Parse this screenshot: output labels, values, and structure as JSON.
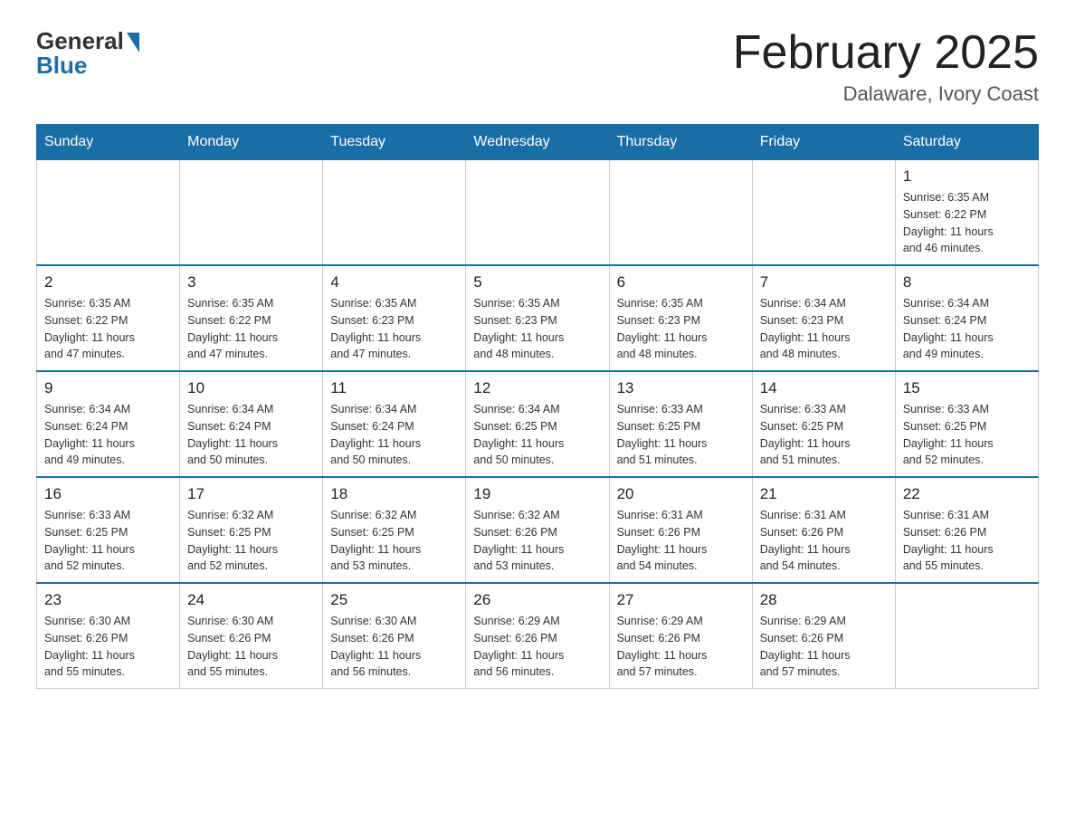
{
  "logo": {
    "general": "General",
    "blue": "Blue"
  },
  "title": "February 2025",
  "location": "Dalaware, Ivory Coast",
  "days_of_week": [
    "Sunday",
    "Monday",
    "Tuesday",
    "Wednesday",
    "Thursday",
    "Friday",
    "Saturday"
  ],
  "weeks": [
    [
      {
        "day": "",
        "info": ""
      },
      {
        "day": "",
        "info": ""
      },
      {
        "day": "",
        "info": ""
      },
      {
        "day": "",
        "info": ""
      },
      {
        "day": "",
        "info": ""
      },
      {
        "day": "",
        "info": ""
      },
      {
        "day": "1",
        "info": "Sunrise: 6:35 AM\nSunset: 6:22 PM\nDaylight: 11 hours\nand 46 minutes."
      }
    ],
    [
      {
        "day": "2",
        "info": "Sunrise: 6:35 AM\nSunset: 6:22 PM\nDaylight: 11 hours\nand 47 minutes."
      },
      {
        "day": "3",
        "info": "Sunrise: 6:35 AM\nSunset: 6:22 PM\nDaylight: 11 hours\nand 47 minutes."
      },
      {
        "day": "4",
        "info": "Sunrise: 6:35 AM\nSunset: 6:23 PM\nDaylight: 11 hours\nand 47 minutes."
      },
      {
        "day": "5",
        "info": "Sunrise: 6:35 AM\nSunset: 6:23 PM\nDaylight: 11 hours\nand 48 minutes."
      },
      {
        "day": "6",
        "info": "Sunrise: 6:35 AM\nSunset: 6:23 PM\nDaylight: 11 hours\nand 48 minutes."
      },
      {
        "day": "7",
        "info": "Sunrise: 6:34 AM\nSunset: 6:23 PM\nDaylight: 11 hours\nand 48 minutes."
      },
      {
        "day": "8",
        "info": "Sunrise: 6:34 AM\nSunset: 6:24 PM\nDaylight: 11 hours\nand 49 minutes."
      }
    ],
    [
      {
        "day": "9",
        "info": "Sunrise: 6:34 AM\nSunset: 6:24 PM\nDaylight: 11 hours\nand 49 minutes."
      },
      {
        "day": "10",
        "info": "Sunrise: 6:34 AM\nSunset: 6:24 PM\nDaylight: 11 hours\nand 50 minutes."
      },
      {
        "day": "11",
        "info": "Sunrise: 6:34 AM\nSunset: 6:24 PM\nDaylight: 11 hours\nand 50 minutes."
      },
      {
        "day": "12",
        "info": "Sunrise: 6:34 AM\nSunset: 6:25 PM\nDaylight: 11 hours\nand 50 minutes."
      },
      {
        "day": "13",
        "info": "Sunrise: 6:33 AM\nSunset: 6:25 PM\nDaylight: 11 hours\nand 51 minutes."
      },
      {
        "day": "14",
        "info": "Sunrise: 6:33 AM\nSunset: 6:25 PM\nDaylight: 11 hours\nand 51 minutes."
      },
      {
        "day": "15",
        "info": "Sunrise: 6:33 AM\nSunset: 6:25 PM\nDaylight: 11 hours\nand 52 minutes."
      }
    ],
    [
      {
        "day": "16",
        "info": "Sunrise: 6:33 AM\nSunset: 6:25 PM\nDaylight: 11 hours\nand 52 minutes."
      },
      {
        "day": "17",
        "info": "Sunrise: 6:32 AM\nSunset: 6:25 PM\nDaylight: 11 hours\nand 52 minutes."
      },
      {
        "day": "18",
        "info": "Sunrise: 6:32 AM\nSunset: 6:25 PM\nDaylight: 11 hours\nand 53 minutes."
      },
      {
        "day": "19",
        "info": "Sunrise: 6:32 AM\nSunset: 6:26 PM\nDaylight: 11 hours\nand 53 minutes."
      },
      {
        "day": "20",
        "info": "Sunrise: 6:31 AM\nSunset: 6:26 PM\nDaylight: 11 hours\nand 54 minutes."
      },
      {
        "day": "21",
        "info": "Sunrise: 6:31 AM\nSunset: 6:26 PM\nDaylight: 11 hours\nand 54 minutes."
      },
      {
        "day": "22",
        "info": "Sunrise: 6:31 AM\nSunset: 6:26 PM\nDaylight: 11 hours\nand 55 minutes."
      }
    ],
    [
      {
        "day": "23",
        "info": "Sunrise: 6:30 AM\nSunset: 6:26 PM\nDaylight: 11 hours\nand 55 minutes."
      },
      {
        "day": "24",
        "info": "Sunrise: 6:30 AM\nSunset: 6:26 PM\nDaylight: 11 hours\nand 55 minutes."
      },
      {
        "day": "25",
        "info": "Sunrise: 6:30 AM\nSunset: 6:26 PM\nDaylight: 11 hours\nand 56 minutes."
      },
      {
        "day": "26",
        "info": "Sunrise: 6:29 AM\nSunset: 6:26 PM\nDaylight: 11 hours\nand 56 minutes."
      },
      {
        "day": "27",
        "info": "Sunrise: 6:29 AM\nSunset: 6:26 PM\nDaylight: 11 hours\nand 57 minutes."
      },
      {
        "day": "28",
        "info": "Sunrise: 6:29 AM\nSunset: 6:26 PM\nDaylight: 11 hours\nand 57 minutes."
      },
      {
        "day": "",
        "info": ""
      }
    ]
  ]
}
